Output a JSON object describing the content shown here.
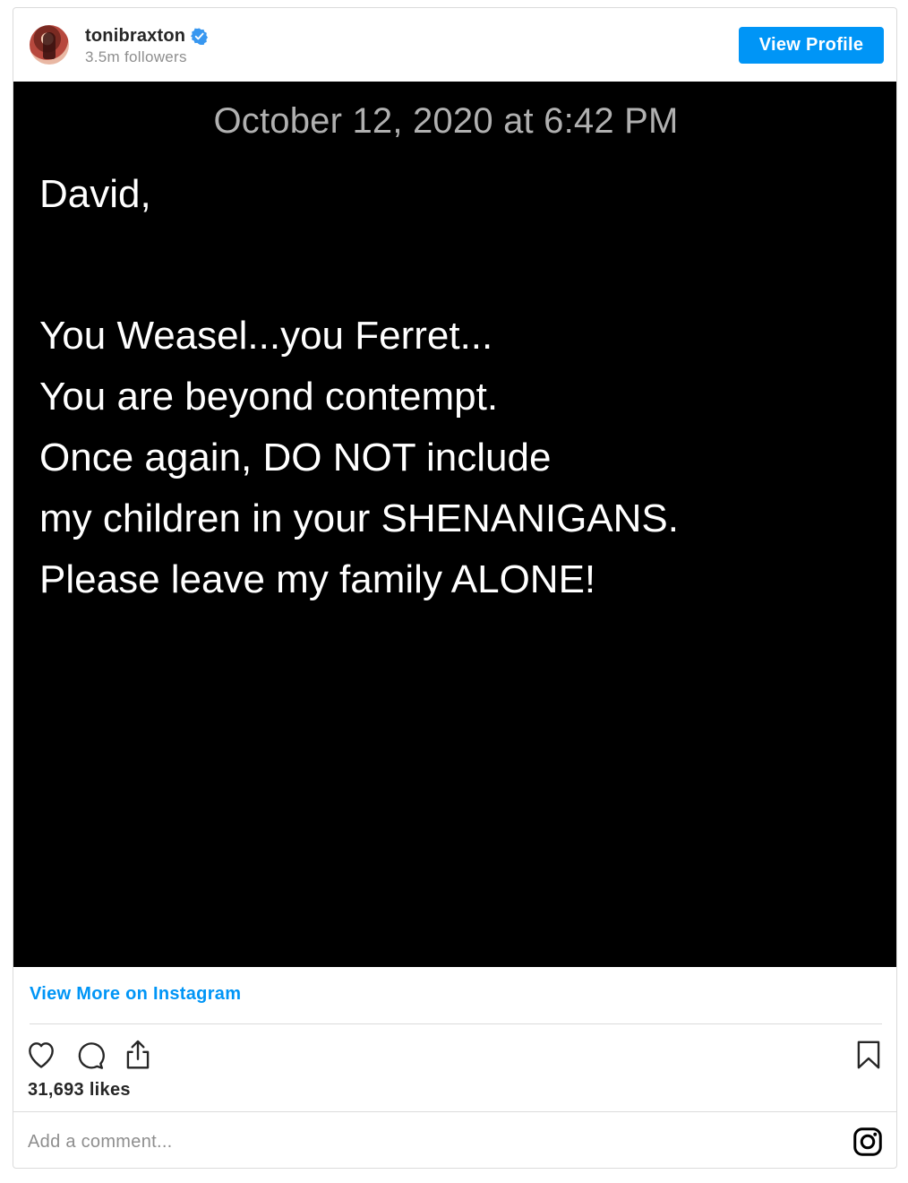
{
  "header": {
    "username": "tonibraxton",
    "followers": "3.5m followers",
    "view_profile_label": "View Profile",
    "verified_icon": "verified-badge-icon"
  },
  "post": {
    "date": "October 12, 2020 at 6:42 PM",
    "lines": [
      "David,",
      "You Weasel...you Ferret...",
      "You are beyond contempt.",
      "Once again, DO NOT include",
      "my children in your SHENANIGANS.",
      "Please leave my family ALONE!"
    ]
  },
  "footer": {
    "view_more_label": "View More on Instagram",
    "likes": "31,693 likes",
    "comment_placeholder": "Add a comment...",
    "icons": [
      "heart-icon",
      "comment-icon",
      "share-icon",
      "bookmark-icon",
      "instagram-icon"
    ]
  },
  "colors": {
    "accent": "#0095f6",
    "post_background": "#000000",
    "date_text": "#b0b0b0",
    "border": "#dbdbdb"
  }
}
